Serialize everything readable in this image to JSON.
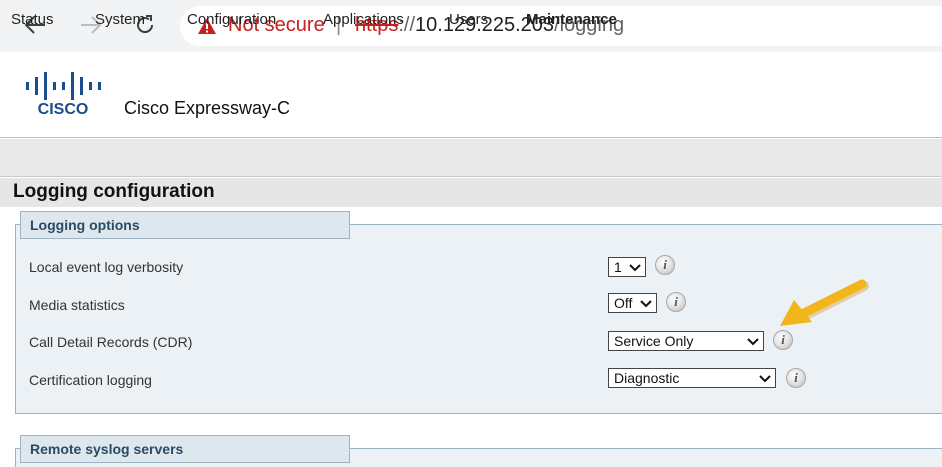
{
  "browser": {
    "security_label": "Not secure",
    "separator": "|",
    "url_scheme": "https",
    "url_separator": "://",
    "url_host": "10.129.225.203",
    "url_path": "/logging",
    "warning_color": "#c5221f",
    "icons": [
      "back-arrow-icon",
      "forward-arrow-icon",
      "reload-icon",
      "warning-icon"
    ]
  },
  "header": {
    "logo_text": "CISCO",
    "product_name": "Cisco Expressway-C"
  },
  "menu": {
    "items": [
      {
        "label": "Status",
        "active": false
      },
      {
        "label": "System",
        "active": false
      },
      {
        "label": "Configuration",
        "active": false
      },
      {
        "label": "Applications",
        "active": false
      },
      {
        "label": "Users",
        "active": false
      },
      {
        "label": "Maintenance",
        "active": true
      }
    ]
  },
  "page": {
    "title": "Logging configuration"
  },
  "logging_options": {
    "legend": "Logging options",
    "rows": [
      {
        "label": "Local event log verbosity",
        "value": "1"
      },
      {
        "label": "Media statistics",
        "value": "Off"
      },
      {
        "label": "Call Detail Records (CDR)",
        "value": "Service Only"
      },
      {
        "label": "Certification logging",
        "value": "Diagnostic"
      }
    ],
    "info_glyph": "i"
  },
  "remote_syslog": {
    "legend": "Remote syslog servers"
  },
  "annotation": {
    "arrow_color": "#f2b51b",
    "icon": "pointer-arrow-icon"
  }
}
